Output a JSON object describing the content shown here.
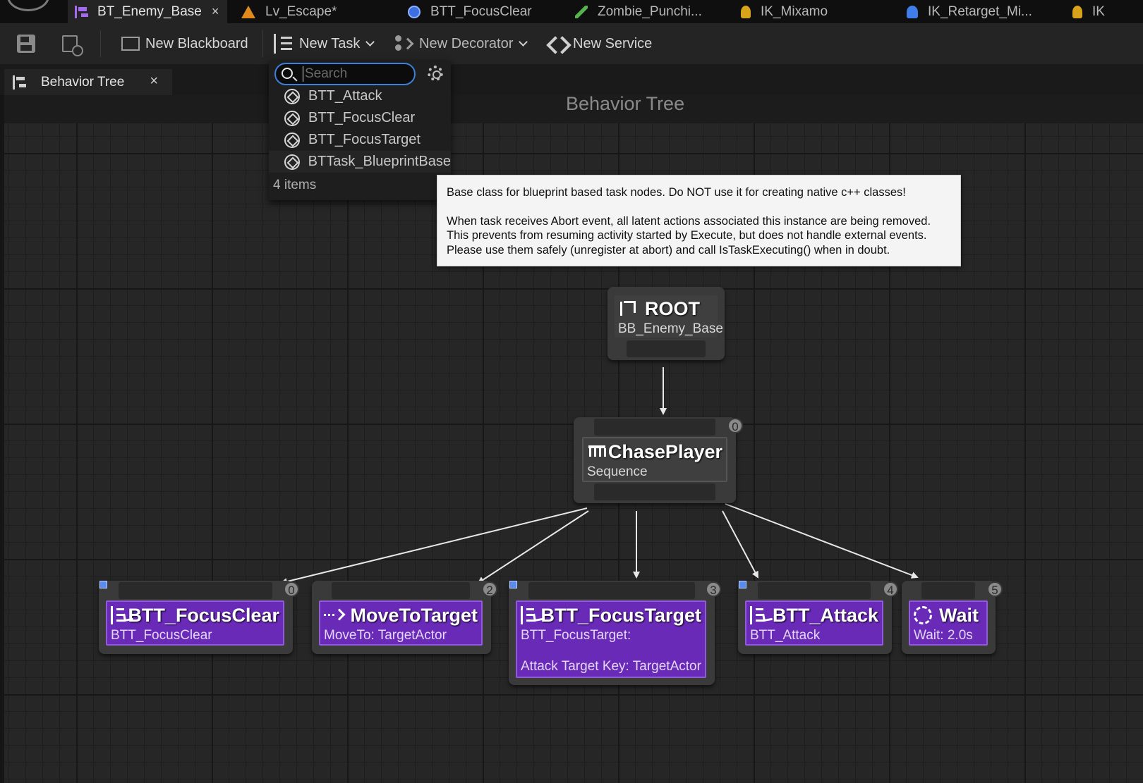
{
  "doc_tabs": [
    {
      "label": "BT_Enemy_Base",
      "icon": "behavior-tree-icon",
      "active": true,
      "closable": true
    },
    {
      "label": "Lv_Escape*",
      "icon": "level-icon"
    },
    {
      "label": "BTT_FocusClear",
      "icon": "blueprint-icon"
    },
    {
      "label": "Zombie_Punchi...",
      "icon": "animation-icon"
    },
    {
      "label": "IK_Mixamo",
      "icon": "ik-rig-icon"
    },
    {
      "label": "IK_Retarget_Mi...",
      "icon": "ik-retargeter-icon"
    },
    {
      "label": "IK",
      "icon": "ik-rig-icon"
    }
  ],
  "toolbar": {
    "new_blackboard": "New Blackboard",
    "new_task": "New Task",
    "new_decorator": "New Decorator",
    "new_service": "New Service"
  },
  "panel_tab": {
    "label": "Behavior Tree"
  },
  "graph": {
    "title": "Behavior Tree",
    "nodes": {
      "root": {
        "title": "ROOT",
        "subtitle": "BB_Enemy_Base"
      },
      "chase": {
        "title": "ChasePlayer",
        "subtitle": "Sequence",
        "index": "0"
      },
      "focusclear": {
        "title": "BTT_FocusClear",
        "subtitle": "BTT_FocusClear",
        "index": "0"
      },
      "moveto": {
        "title": "MoveToTarget",
        "subtitle": "MoveTo: TargetActor",
        "index": "2"
      },
      "focustarget": {
        "title": "BTT_FocusTarget",
        "subtitle": "BTT_FocusTarget:",
        "detail": "Attack Target Key: TargetActor",
        "index": "3"
      },
      "attack": {
        "title": "BTT_Attack",
        "subtitle": "BTT_Attack",
        "index": "4"
      },
      "wait": {
        "title": "Wait",
        "subtitle": "Wait: 2.0s",
        "index": "5"
      }
    }
  },
  "task_menu": {
    "search_placeholder": "Search",
    "items": [
      "BTT_Attack",
      "BTT_FocusClear",
      "BTT_FocusTarget",
      "BTTask_BlueprintBase"
    ],
    "count": "4 items"
  },
  "tooltip": {
    "line1": "Base class for blueprint based task nodes. Do NOT use it for creating native c++ classes!",
    "line2": "When task receives Abort event, all latent actions associated this instance are being removed.",
    "line3": "This prevents from resuming activity started by Execute, but does not handle external events.",
    "line4": "Please use them safely (unregister at abort) and call IsTaskExecuting() when in doubt."
  },
  "colors": {
    "task_node": "#6a2ab8",
    "search_focus": "#3d7fd9",
    "accent_tab_icon": "#a46bf0"
  }
}
